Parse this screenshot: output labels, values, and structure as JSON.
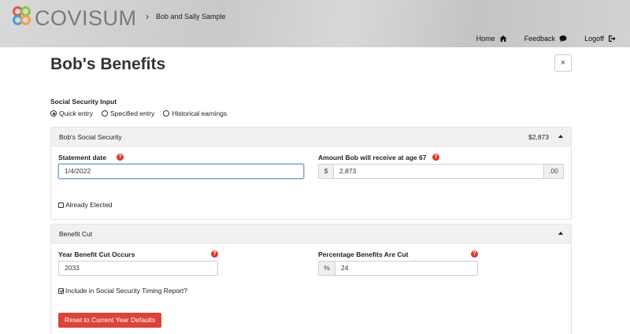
{
  "header": {
    "brand": "COVISUM",
    "breadcrumb_sep": "›",
    "breadcrumb": "Bob and Sally Sample",
    "nav": [
      {
        "label": "Home",
        "icon": "home-icon"
      },
      {
        "label": "Feedback",
        "icon": "comment-icon"
      },
      {
        "label": "Logoff",
        "icon": "logout-icon"
      }
    ],
    "logo_colors": [
      "#e0584a",
      "#8cc63f",
      "#4a9fd8",
      "#f0a04b"
    ]
  },
  "page": {
    "title": "Bob's Benefits",
    "close": "×"
  },
  "ss_input": {
    "label": "Social Security Input",
    "options": [
      {
        "label": "Quick entry",
        "selected": true
      },
      {
        "label": "Specified entry",
        "selected": false
      },
      {
        "label": "Historical earnings",
        "selected": false
      }
    ]
  },
  "panel_ss": {
    "title": "Bob's Social Security",
    "amount": "$2,873",
    "statement_label": "Statement date",
    "statement_value": "1/4/2022",
    "receive_label": "Amount Bob will receive at age 67",
    "currency": "$",
    "receive_value": "2,873",
    "cents": ".00",
    "elected_label": "Already Elected",
    "elected": false
  },
  "panel_cut": {
    "title": "Benefit Cut",
    "year_label": "Year Benefit Cut Occurs",
    "year_value": "2033",
    "pct_label": "Percentage Benefits Are Cut",
    "pct_symbol": "%",
    "pct_value": "24",
    "include_label": "Include in Social Security Timing Report?",
    "include": true,
    "reset_label": "Reset to Current Year Defaults"
  },
  "help_glyph": "?",
  "colors": {
    "accent_red": "#db4437",
    "help_red": "#d9392c",
    "focus_blue": "#7aa6d9"
  }
}
